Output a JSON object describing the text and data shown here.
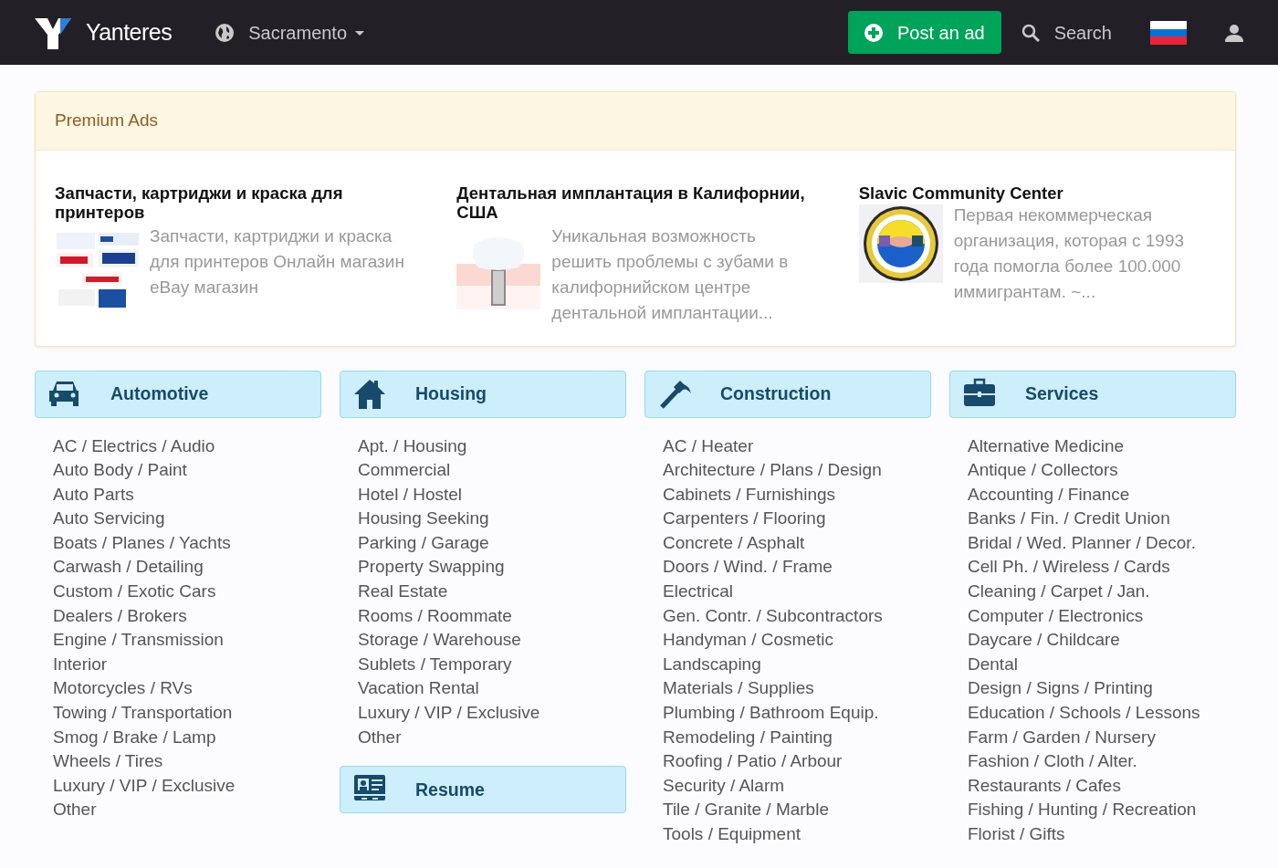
{
  "navbar": {
    "brand": "Yanteres",
    "city": "Sacramento",
    "post_button": "Post an ad",
    "search": "Search"
  },
  "premium": {
    "title": "Premium Ads",
    "ads": [
      {
        "title": "Запчасти, картриджи и краска для принтеров",
        "text": "Запчасти, картриджи и краска для принтеров Онлайн магазин eBay магазин"
      },
      {
        "title": "Дентальная имплантация в Калифорнии, США",
        "text": "Уникальная возможность решить проблемы с зубами в калифорнийском центре дентальной имплантации..."
      },
      {
        "title": "Slavic Community Center",
        "text": "Первая некоммерческая организация, которая с 1993 года помогла более 100.000 иммигрантам. ~..."
      }
    ]
  },
  "columns": [
    {
      "sections": [
        {
          "title": "Automotive",
          "items": [
            "AC / Electrics / Audio",
            "Auto Body / Paint",
            "Auto Parts",
            "Auto Servicing",
            "Boats / Planes / Yachts",
            "Carwash / Detailing",
            "Custom / Exotic Cars",
            "Dealers / Brokers",
            "Engine / Transmission",
            "Interior",
            "Motorcycles / RVs",
            "Towing / Transportation",
            "Smog / Brake / Lamp",
            "Wheels / Tires",
            "Luxury / VIP / Exclusive",
            "Other"
          ]
        }
      ]
    },
    {
      "sections": [
        {
          "title": "Housing",
          "items": [
            "Apt. / Housing",
            "Commercial",
            "Hotel / Hostel",
            "Housing Seeking",
            "Parking / Garage",
            "Property Swapping",
            "Real Estate",
            "Rooms / Roommate",
            "Storage / Warehouse",
            "Sublets / Temporary",
            "Vacation Rental",
            "Luxury / VIP / Exclusive",
            "Other"
          ]
        },
        {
          "title": "Resume"
        }
      ]
    },
    {
      "sections": [
        {
          "title": "Construction",
          "items": [
            "AC / Heater",
            "Architecture / Plans / Design",
            "Cabinets / Furnishings",
            "Carpenters / Flooring",
            "Concrete / Asphalt",
            "Doors / Wind. / Frame",
            "Electrical",
            "Gen. Contr. / Subcontractors",
            "Handyman / Cosmetic",
            "Landscaping",
            "Materials / Supplies",
            "Plumbing / Bathroom Equip.",
            "Remodeling / Painting",
            "Roofing / Patio / Arbour",
            "Security / Alarm",
            "Tile / Granite / Marble",
            "Tools / Equipment"
          ]
        }
      ]
    },
    {
      "sections": [
        {
          "title": "Services",
          "items": [
            "Alternative Medicine",
            "Antique / Collectors",
            "Accounting / Finance",
            "Banks / Fin. / Credit Union",
            "Bridal / Wed. Planner / Decor.",
            "Cell Ph. / Wireless / Cards",
            "Cleaning / Carpet / Jan.",
            "Computer / Electronics",
            "Daycare / Childcare",
            "Dental",
            "Design / Signs / Printing",
            "Education / Schools / Lessons",
            "Farm / Garden / Nursery",
            "Fashion / Cloth / Alter.",
            "Restaurants / Cafes",
            "Fishing / Hunting / Recreation",
            "Florist / Gifts"
          ]
        }
      ]
    }
  ]
}
